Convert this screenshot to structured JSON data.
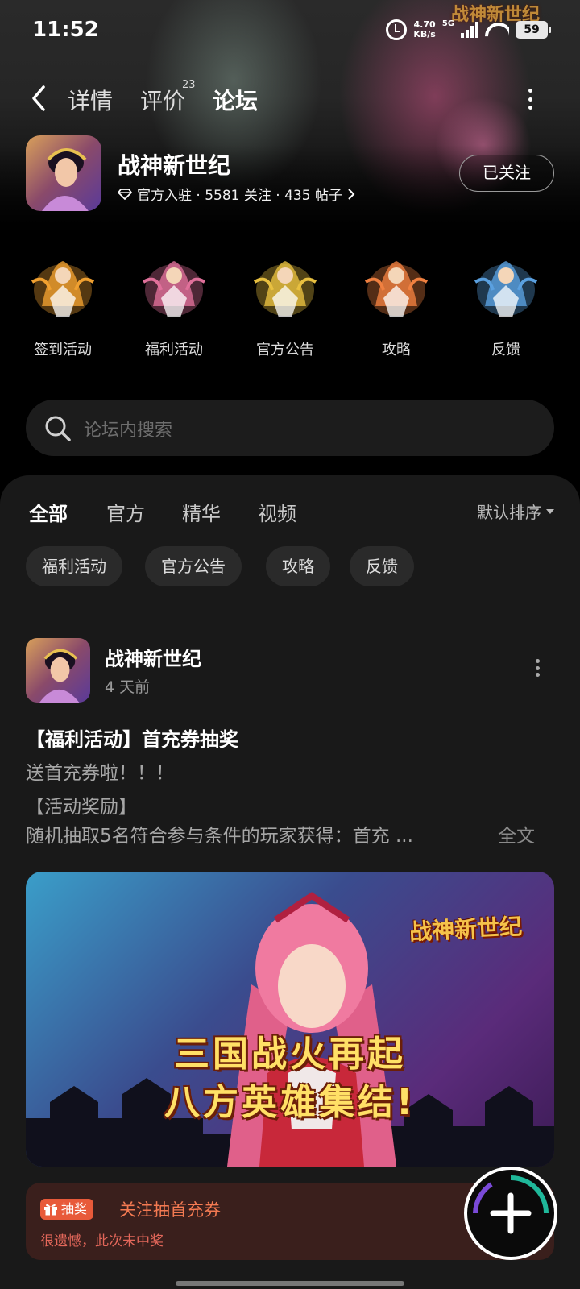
{
  "status_bar": {
    "time": "11:52",
    "net_speed": "4.70",
    "net_unit": "KB/s",
    "network": "5G",
    "battery": "59"
  },
  "nav": {
    "tabs": [
      {
        "label": "详情"
      },
      {
        "label": "评价",
        "badge": "23"
      },
      {
        "label": "论坛",
        "active": true
      }
    ]
  },
  "hero": {
    "logo_text": "战神新世纪"
  },
  "game": {
    "title": "战神新世纪",
    "meta": "官方入驻 · 5581 关注 · 435 帖子",
    "follow_label": "已关注"
  },
  "quick_entries": [
    {
      "label": "签到活动",
      "icon": "phoenix-hero-icon",
      "color": "#f0a030"
    },
    {
      "label": "福利活动",
      "icon": "dancer-hero-icon",
      "color": "#e0709a"
    },
    {
      "label": "官方公告",
      "icon": "dragon-hero-icon",
      "color": "#e8c040"
    },
    {
      "label": "攻略",
      "icon": "tiger-hero-icon",
      "color": "#f08040"
    },
    {
      "label": "反馈",
      "icon": "ice-dragon-hero-icon",
      "color": "#5aa0e0"
    }
  ],
  "search": {
    "placeholder": "论坛内搜索"
  },
  "feed": {
    "tabs": [
      {
        "label": "全部",
        "active": true
      },
      {
        "label": "官方"
      },
      {
        "label": "精华"
      },
      {
        "label": "视频"
      }
    ],
    "sort_label": "默认排序",
    "chips": [
      "福利活动",
      "官方公告",
      "攻略",
      "反馈"
    ]
  },
  "post": {
    "author": "战神新世纪",
    "time": "4 天前",
    "title": "【福利活动】首充券抽奖",
    "lines": [
      "送首充券啦！！！",
      "【活动奖励】",
      "随机抽取5名符合参与条件的玩家获得：首充 ..."
    ],
    "read_more": "全文",
    "banner": {
      "logo": "战神新世纪",
      "slogan_1": "三国战火再起",
      "slogan_2": "八方英雄集结!"
    },
    "lottery": {
      "tag": "抽奖",
      "title": "关注抽首充券",
      "subtitle": "很遗憾，此次未中奖"
    }
  },
  "colors": {
    "accent": "#1fb89a",
    "panel_bg": "#191919",
    "lottery_bg": "#3a1f1c",
    "lottery_text": "#f47a52"
  }
}
